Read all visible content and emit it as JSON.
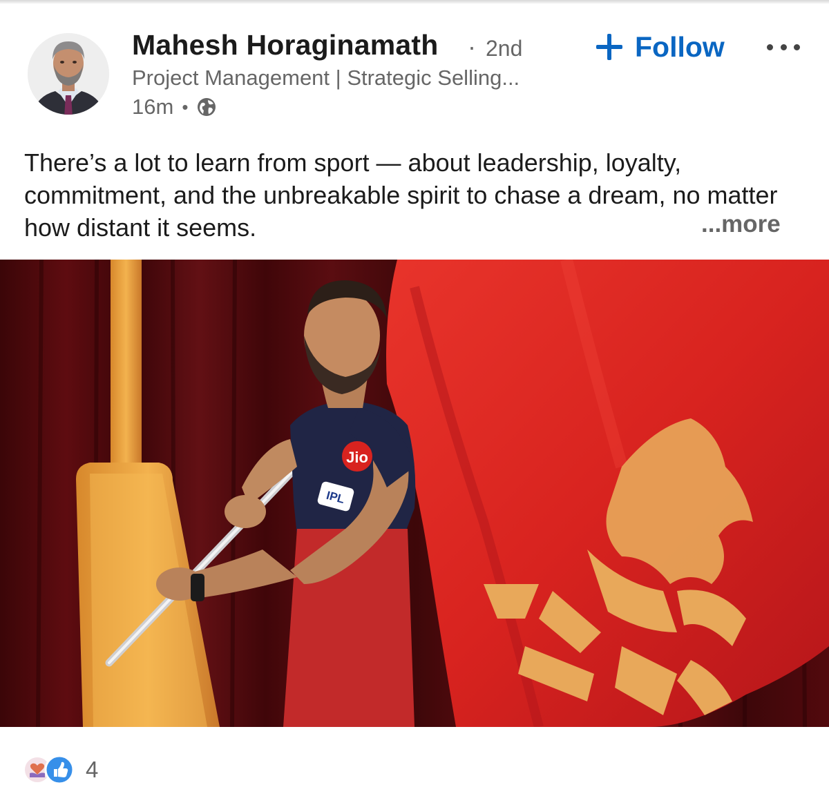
{
  "post": {
    "author": {
      "name": "Mahesh Horaginamath",
      "degree": "2nd",
      "headline": "Project Management | Strategic Selling...",
      "time": "16m",
      "visibility_icon": "globe-icon",
      "avatar_icon": "avatar"
    },
    "actions": {
      "follow_label": "Follow",
      "follow_icon": "plus-icon",
      "more_icon": "more-options-icon"
    },
    "text": "There’s a lot to learn from sport — about leadership, loyalty, commitment, and the unbreakable spirit to chase a dream, no matter how distant it seems.",
    "see_more_label": "...more",
    "image": {
      "description_icon": "post-photo",
      "jersey_badge": "Jio",
      "jersey_logo": "IPL"
    },
    "reactions": {
      "icons": [
        "love-reaction-icon",
        "like-reaction-icon"
      ],
      "count": "4"
    }
  },
  "colors": {
    "link_blue": "#0a66c2",
    "secondary_text": "#666666",
    "primary_text": "#1b1b1b",
    "flag_red": "#d8231f",
    "flag_gold": "#e8a85a"
  }
}
